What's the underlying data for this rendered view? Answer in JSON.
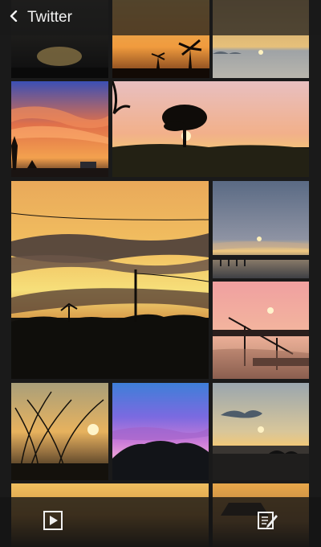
{
  "header": {
    "title": "Twitter",
    "back_icon": "chevron-left-icon"
  },
  "toolbar": {
    "left_icon": "slideshow-play-icon",
    "right_icon": "edit-compose-icon"
  },
  "colors": {
    "background": "#1a1a1a",
    "bar": "#191919",
    "text": "#f2f2f2"
  }
}
